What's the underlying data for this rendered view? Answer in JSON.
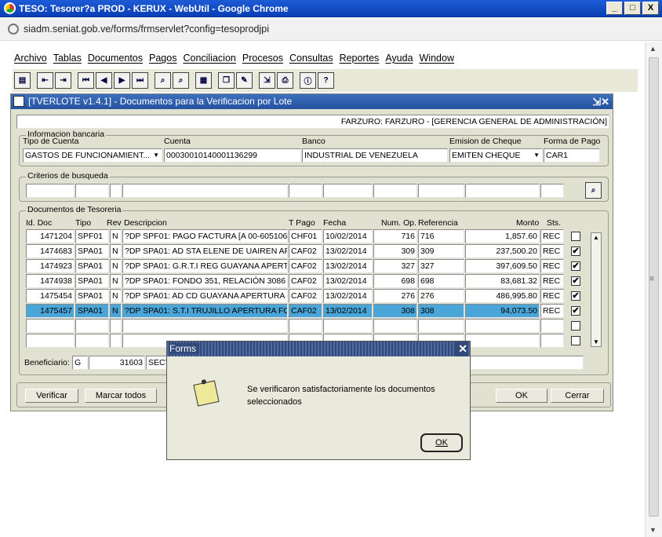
{
  "chrome": {
    "title": "TESO: Tesorer?a PROD - KERUX - WebUtil - Google Chrome",
    "url": "siadm.seniat.gob.ve/forms/frmservlet?config=tesoprodjpi",
    "min": "_",
    "max": "□",
    "close": "X"
  },
  "menu": [
    "Archivo",
    "Tablas",
    "Documentos",
    "Pagos",
    "Conciliacion",
    "Procesos",
    "Consultas",
    "Reportes",
    "Ayuda",
    "Window"
  ],
  "form": {
    "title": "[TVERLOTE v1.4.1] - Documentos para la Verificacion por Lote",
    "title_controls": "⇲✕",
    "header_info": "FARZURO: FARZURO -  [GERENCIA GENERAL DE ADMINISTRACIÓN]",
    "bank_group": "Informacion bancaria",
    "labels": {
      "tipo_cuenta": "Tipo de Cuenta",
      "cuenta": "Cuenta",
      "banco": "Banco",
      "emision": "Emision de Cheque",
      "forma_pago": "Forma de Pago"
    },
    "values": {
      "tipo_cuenta": "GASTOS DE FUNCIONAMIENT...",
      "cuenta": "00030010140001136299",
      "banco": "INDUSTRIAL DE VENEZUELA",
      "emision": "EMITEN CHEQUE",
      "forma_pago": "CAR1"
    },
    "search_group": "Criterios de busqueda",
    "docs_group": "Documentos de Tesoreria",
    "columns": {
      "id": "Id. Doc",
      "tipo": "Tipo",
      "rev": "Rev",
      "desc": "Descripcion",
      "tpago": "T Pago",
      "fecha": "Fecha",
      "numop": "Num. Op.",
      "ref": "Referencia",
      "monto": "Monto",
      "sts": "Sts."
    },
    "rows": [
      {
        "id": "1471204",
        "tipo": "SPF01",
        "rev": "N",
        "desc": "?DP SPF01: PAGO FACTURA [A 00-605106",
        "tpago": "CHF01",
        "fecha": "10/02/2014",
        "numop": "716",
        "ref": "716",
        "monto": "1,857.60",
        "sts": "REC",
        "check": ""
      },
      {
        "id": "1474683",
        "tipo": "SPA01",
        "rev": "N",
        "desc": "?DP SPA01: AD STA ELENE DE UAIREN AP",
        "tpago": "CAF02",
        "fecha": "13/02/2014",
        "numop": "309",
        "ref": "309",
        "monto": "237,500.20",
        "sts": "REC",
        "check": "✔"
      },
      {
        "id": "1474923",
        "tipo": "SPA01",
        "rev": "N",
        "desc": "?DP SPA01: G.R.T.I REG GUAYANA APERT",
        "tpago": "CAF02",
        "fecha": "13/02/2014",
        "numop": "327",
        "ref": "327",
        "monto": "397,609.50",
        "sts": "REC",
        "check": "✔"
      },
      {
        "id": "1474938",
        "tipo": "SPA01",
        "rev": "N",
        "desc": "?DP SPA01: FONDO 351, RELACIÓN 3086",
        "tpago": "CAF02",
        "fecha": "13/02/2014",
        "numop": "698",
        "ref": "698",
        "monto": "83,681.32",
        "sts": "REC",
        "check": "✔"
      },
      {
        "id": "1475454",
        "tipo": "SPA01",
        "rev": "N",
        "desc": "?DP SPA01: AD CD GUAYANA APERTURA",
        "tpago": "CAF02",
        "fecha": "13/02/2014",
        "numop": "276",
        "ref": "276",
        "monto": "486,995.80",
        "sts": "REC",
        "check": "✔"
      },
      {
        "id": "1475457",
        "tipo": "SPA01",
        "rev": "N",
        "desc": "?DP SPA01: S.T.I TRUJILLO APERTURA FO",
        "tpago": "CAF02",
        "fecha": "13/02/2014",
        "numop": "308",
        "ref": "308",
        "monto": "94,073.50",
        "sts": "REC",
        "check": "✔"
      }
    ],
    "beneficiario_label": "Beneficiario:",
    "beneficiario_type": "G",
    "beneficiario_code": "31603",
    "beneficiario_name": "SECT",
    "buttons": {
      "verificar": "Verificar",
      "marcar": "Marcar todos",
      "ok": "OK",
      "cerrar": "Cerrar"
    }
  },
  "dialog": {
    "title": "Forms",
    "message": "Se verificaron satisfactoriamente los documentos seleccionados",
    "ok": "OK"
  }
}
